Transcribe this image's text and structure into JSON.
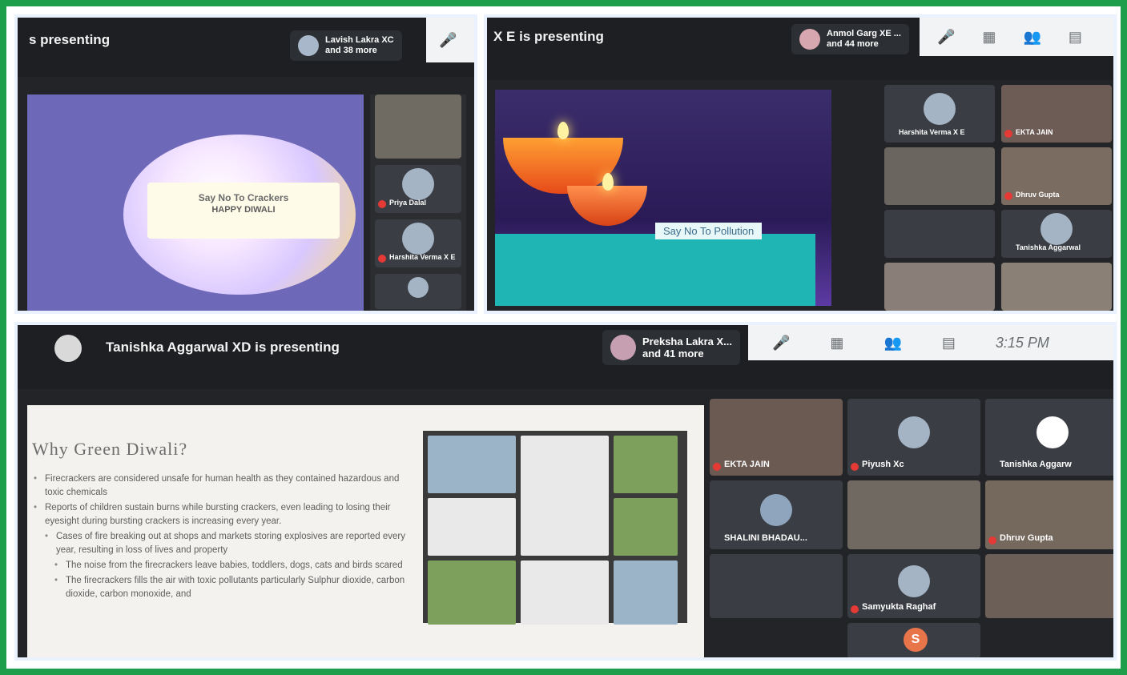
{
  "panel1": {
    "presenting_text": "s presenting",
    "participants_chip": {
      "line1": "Lavish Lakra XC",
      "line2": "and 38 more"
    },
    "slide": {
      "line1": "Say No To Crackers",
      "line2": "HAPPY DIWALI"
    },
    "tiles": [
      {
        "name": "Priya Dalal"
      },
      {
        "name": "Harshita Verma X E"
      }
    ]
  },
  "panel2": {
    "presenting_text": "X E is presenting",
    "participants_chip": {
      "line1": "Anmol Garg XE ...",
      "line2": "and 44 more"
    },
    "slide": {
      "title": "Say No To Pollution"
    },
    "tiles": [
      {
        "name": "Harshita Verma X E"
      },
      {
        "name": "EKTA JAIN"
      },
      {
        "name": "Dhruv Gupta"
      },
      {
        "name": "Tanishka Aggarwal"
      }
    ]
  },
  "panel3": {
    "presenting_text": "Tanishka Aggarwal XD is presenting",
    "participants_chip": {
      "line1": "Preksha Lakra X...",
      "line2": "and 41 more"
    },
    "clock": "3:15 PM",
    "slide": {
      "title": "Why Green Diwali?",
      "bullets": [
        {
          "level": 0,
          "text": "Firecrackers are considered unsafe for human health as they contained hazardous and toxic chemicals"
        },
        {
          "level": 0,
          "text": "Reports of children sustain burns while bursting crackers, even leading to losing their eyesight during bursting crackers is increasing every year."
        },
        {
          "level": 1,
          "text": "Cases of fire breaking out at shops and markets storing explosives are reported every year, resulting in loss of lives and property"
        },
        {
          "level": 2,
          "text": "The noise from the firecrackers leave babies, toddlers, dogs, cats and birds scared"
        },
        {
          "level": 2,
          "text": "The firecrackers fills the air with toxic pollutants particularly Sulphur dioxide, carbon dioxide, carbon monoxide, and"
        }
      ]
    },
    "tiles": [
      {
        "name": "EKTA JAIN"
      },
      {
        "name": "Piyush Xc"
      },
      {
        "name": "Tanishka Aggarw"
      },
      {
        "name": "SHALINI BHADAU..."
      },
      {
        "name": "Dhruv Gupta"
      },
      {
        "name": "Samyukta Raghaf"
      },
      {
        "name": "S"
      }
    ]
  },
  "colors": {
    "border_green": "#1e9d4a",
    "meet_dark": "#1d1f22",
    "slide_purple": "#6e68b8",
    "pollution_teal": "#1fb5b5"
  }
}
